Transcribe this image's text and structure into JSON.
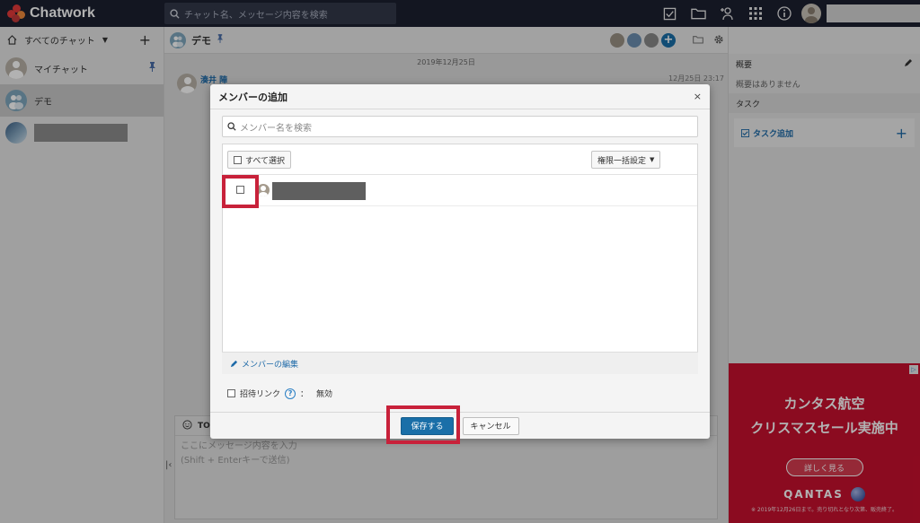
{
  "header": {
    "logo_text": "Chatwork",
    "search_placeholder": "チャット名、メッセージ内容を検索"
  },
  "sidebar": {
    "filter_label": "すべてのチャット",
    "rooms": [
      {
        "label": "マイチャット",
        "pinned": true
      },
      {
        "label": "デモ",
        "active": true
      },
      {
        "label": ""
      }
    ]
  },
  "chat": {
    "title": "デモ",
    "date_separator": "2019年12月25日",
    "author": "湊井 陣",
    "time": "12月25日 23:17",
    "composer_to": "TO",
    "composer_placeholder_1": "ここにメッセージ内容を入力",
    "composer_placeholder_2": "(Shift + Enterキーで送信)"
  },
  "rpanel": {
    "summary_title": "概要",
    "summary_body": "概要はありません",
    "task_title": "タスク",
    "task_add": "タスク追加"
  },
  "ad": {
    "line1": "カンタス航空",
    "line2": "クリスマスセール実施中",
    "button": "詳しく見る",
    "brand": "QANTAS",
    "fine": "※ 2019年12月26日まで。売り切れとなり次第、販売終了。",
    "badge": "▷"
  },
  "modal": {
    "title": "メンバーの追加",
    "close": "×",
    "search_placeholder": "メンバー名を検索",
    "select_all": "すべて選択",
    "bulk_permission": "権限一括設定",
    "edit_members": "メンバーの編集",
    "invite_link": "招待リンク",
    "help": "?",
    "colon": "：",
    "invite_status": "無効",
    "save": "保存する",
    "cancel": "キャンセル"
  },
  "colors": {
    "accent": "#1a6fa8",
    "highlight": "#c8213a",
    "topbar": "#1c2030",
    "ad_red": "#c8102e"
  }
}
